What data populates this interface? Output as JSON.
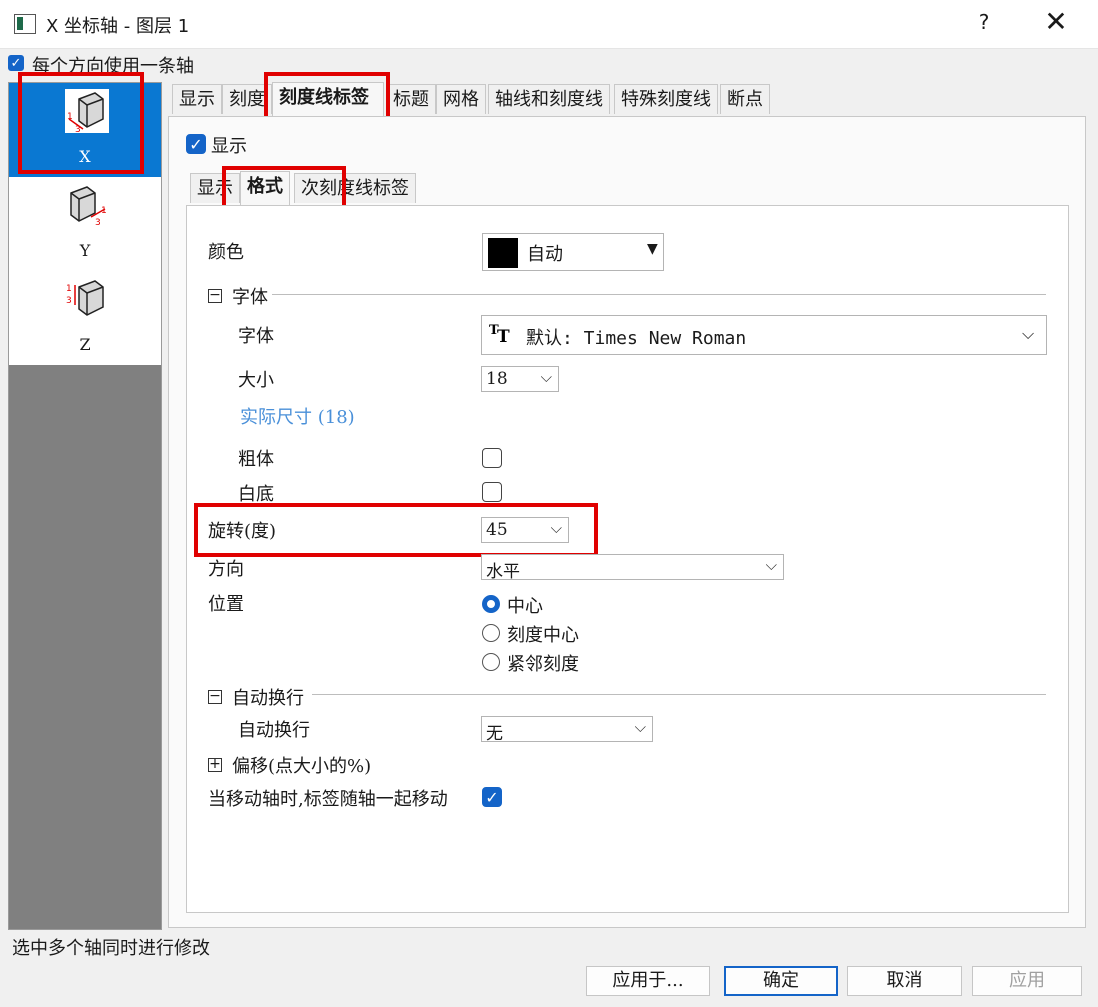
{
  "window": {
    "title": "X 坐标轴 - 图层 1",
    "help_label": "?",
    "close_label": "✕"
  },
  "top_option": {
    "label": "每个方向使用一条轴",
    "checked": true
  },
  "axes": [
    {
      "label": "X",
      "selected": true
    },
    {
      "label": "Y",
      "selected": false
    },
    {
      "label": "Z",
      "selected": false
    }
  ],
  "tabs": [
    "显示",
    "刻度",
    "刻度线标签",
    "标题",
    "网格",
    "轴线和刻度线",
    "特殊刻度线",
    "断点"
  ],
  "active_tab": "刻度线标签",
  "show_checkbox": {
    "label": "显示",
    "checked": true
  },
  "subtabs": [
    "显示",
    "格式",
    "次刻度线标签"
  ],
  "active_subtab": "格式",
  "format": {
    "color": {
      "label": "颜色",
      "value": "自动",
      "swatch": "#000000"
    },
    "font_section": {
      "title": "字体",
      "expanded": true
    },
    "font": {
      "label": "字体",
      "value": "默认: Times New Roman",
      "icon": "truetype-font-icon"
    },
    "size": {
      "label": "大小",
      "value": "18"
    },
    "actual_size": "实际尺寸 (18)",
    "bold": {
      "label": "粗体",
      "checked": false
    },
    "white_bg": {
      "label": "白底",
      "checked": false
    },
    "rotation": {
      "label": "旋转(度)",
      "value": "45"
    },
    "direction": {
      "label": "方向",
      "value": "水平"
    },
    "position": {
      "label": "位置",
      "options": [
        "中心",
        "刻度中心",
        "紧邻刻度"
      ],
      "selected": "中心"
    },
    "wrap_section": {
      "title": "自动换行",
      "expanded": true
    },
    "wrap": {
      "label": "自动换行",
      "value": "无"
    },
    "offset_section": {
      "title": "偏移(点大小的%)",
      "expanded": false
    },
    "move_with_axis": {
      "label": "当移动轴时,标签随轴一起移动",
      "checked": true
    }
  },
  "status_text": "选中多个轴同时进行修改",
  "buttons": {
    "apply_to": "应用于...",
    "ok": "确定",
    "cancel": "取消",
    "apply": "应用"
  },
  "colors": {
    "selection_blue": "#0a78d2",
    "check_blue": "#1464c8",
    "highlight_red": "#e00000",
    "link_blue": "#4a90d9"
  }
}
